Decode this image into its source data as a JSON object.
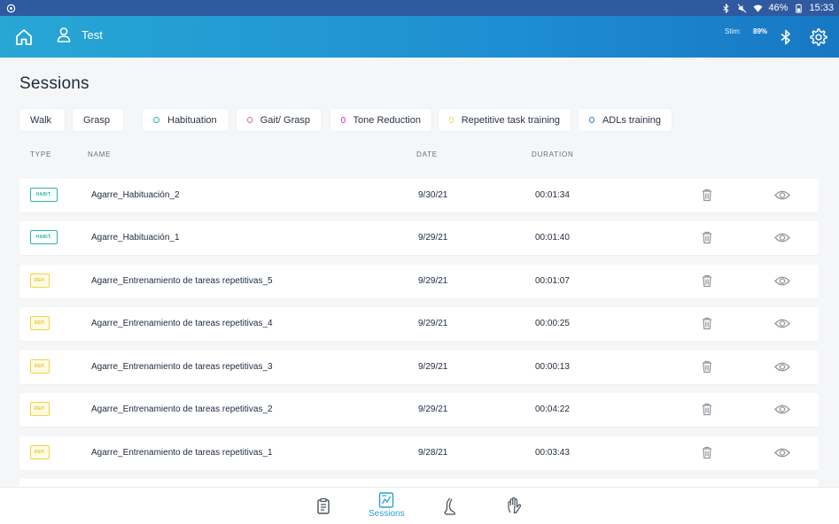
{
  "status_bar": {
    "battery": "46%",
    "time": "15:33"
  },
  "app_bar": {
    "user_name": "Test",
    "stim_label": "Stim:",
    "stim_value": "89%"
  },
  "page": {
    "title": "Sessions"
  },
  "filters": [
    {
      "label": "Walk",
      "dot_color": null
    },
    {
      "label": "Grasp",
      "dot_color": null
    },
    {
      "label": "Habituation",
      "dot_color": "#2bb4a8"
    },
    {
      "label": "Gait/ Grasp",
      "dot_color": "#e06aa6"
    },
    {
      "label": "Tone Reduction",
      "dot_color": "#c33fc9"
    },
    {
      "label": "Repetitive task training",
      "dot_color": "#e9d85a"
    },
    {
      "label": "ADLs training",
      "dot_color": "#3b7dbf"
    }
  ],
  "columns": {
    "type": "TYPE",
    "name": "NAME",
    "date": "DATE",
    "duration": "DURATION"
  },
  "sessions": [
    {
      "type": "HABIT.",
      "kind": "habit",
      "name": "Agarre_Habituación_2",
      "date": "9/30/21",
      "duration": "00:01:34"
    },
    {
      "type": "HABIT.",
      "kind": "habit",
      "name": "Agarre_Habituación_1",
      "date": "9/29/21",
      "duration": "00:01:40"
    },
    {
      "type": "REP.",
      "kind": "rep",
      "name": "Agarre_Entrenamiento de tareas repetitivas_5",
      "date": "9/29/21",
      "duration": "00:01:07"
    },
    {
      "type": "REP.",
      "kind": "rep",
      "name": "Agarre_Entrenamiento de tareas repetitivas_4",
      "date": "9/29/21",
      "duration": "00:00:25"
    },
    {
      "type": "REP.",
      "kind": "rep",
      "name": "Agarre_Entrenamiento de tareas repetitivas_3",
      "date": "9/29/21",
      "duration": "00:00:13"
    },
    {
      "type": "REP.",
      "kind": "rep",
      "name": "Agarre_Entrenamiento de tareas repetitivas_2",
      "date": "9/29/21",
      "duration": "00:04:22"
    },
    {
      "type": "REP.",
      "kind": "rep",
      "name": "Agarre_Entrenamiento de tareas repetitivas_1",
      "date": "9/28/21",
      "duration": "00:03:43"
    }
  ],
  "bottom_nav": {
    "active_label": "Sessions",
    "items": [
      "clipboard-icon",
      "sessions-icon",
      "foot-icon",
      "hand-icon"
    ]
  },
  "colors": {
    "accent": "#2a9fd4",
    "header_start": "#27a7d4",
    "header_end": "#1778c3",
    "status_bar": "#2f5aa0"
  }
}
